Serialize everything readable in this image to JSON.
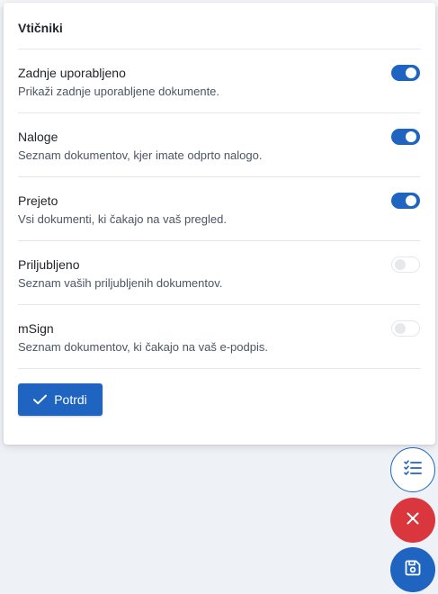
{
  "panel": {
    "title": "Vtičniki",
    "plugins": [
      {
        "label": "Zadnje uporabljeno",
        "description": "Prikaži zadnje uporabljene dokumente.",
        "enabled": true
      },
      {
        "label": "Naloge",
        "description": "Seznam dokumentov, kjer imate odprto nalogo.",
        "enabled": true
      },
      {
        "label": "Prejeto",
        "description": "Vsi dokumenti, ki čakajo na vaš pregled.",
        "enabled": true
      },
      {
        "label": "Priljubljeno",
        "description": "Seznam vaših priljubljenih dokumentov.",
        "enabled": false
      },
      {
        "label": "mSign",
        "description": "Seznam dokumentov, ki čakajo na vaš e-podpis.",
        "enabled": false
      }
    ],
    "confirm_label": "Potrdi"
  },
  "fabs": {
    "checklist_icon": "checklist-icon",
    "close_icon": "close-icon",
    "save_icon": "save-icon"
  },
  "colors": {
    "primary": "#1f64c0",
    "danger": "#d9363e",
    "background": "#eef1f6"
  }
}
